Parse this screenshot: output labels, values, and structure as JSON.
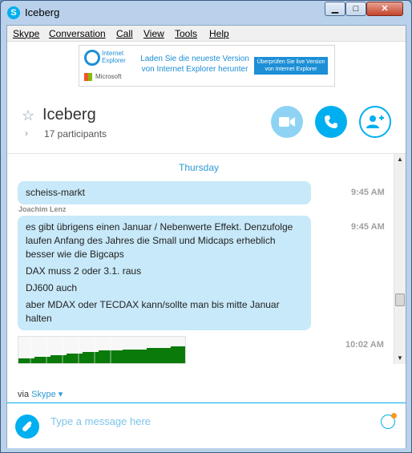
{
  "window": {
    "title": "Iceberg",
    "min_glyph": "▁",
    "max_glyph": "□",
    "close_glyph": "✕"
  },
  "menu": [
    {
      "label": "Skype"
    },
    {
      "label": "Conversation"
    },
    {
      "label": "Call"
    },
    {
      "label": "View"
    },
    {
      "label": "Tools"
    },
    {
      "label": "Help"
    }
  ],
  "ad": {
    "brand": "Internet Explorer",
    "vendor": "Microsoft",
    "text": "Laden Sie die neueste Version von Internet Explorer herunter",
    "button": "Überprüfen Sie live Version von Internet Explorer"
  },
  "conversation": {
    "name": "Iceberg",
    "participants": "17 participants",
    "day": "Thursday",
    "messages": [
      {
        "sender": "",
        "time": "9:45 AM",
        "paragraphs": [
          "scheiss-markt"
        ]
      },
      {
        "sender": "Joachim Lenz",
        "time": "9:45 AM",
        "paragraphs": [
          "es gibt übrigens einen Januar / Nebenwerte Effekt. Denzufolge laufen Anfang des Jahres die Small und Midcaps erheblich besser wie die Bigcaps",
          "DAX muss 2 oder 3.1. raus",
          "DJ600 auch",
          "aber MDAX oder TECDAX kann/sollte man bis mitte Januar halten"
        ]
      },
      {
        "sender": "",
        "time": "10:02 AM",
        "paragraphs": [],
        "image": "chart-image"
      }
    ]
  },
  "footer": {
    "via": "via",
    "via_link": "Skype"
  },
  "compose": {
    "placeholder": "Type a message here"
  },
  "icons": [
    "skype-icon",
    "star-icon",
    "chevron-right-icon",
    "video-call-icon",
    "phone-icon",
    "add-person-icon",
    "attach-icon",
    "emoji-icon",
    "internet-explorer-icon",
    "microsoft-icon"
  ],
  "colors": {
    "skype_blue": "#00aff0",
    "bubble": "#c8e9f9",
    "day_label": "#2f9ad4"
  }
}
